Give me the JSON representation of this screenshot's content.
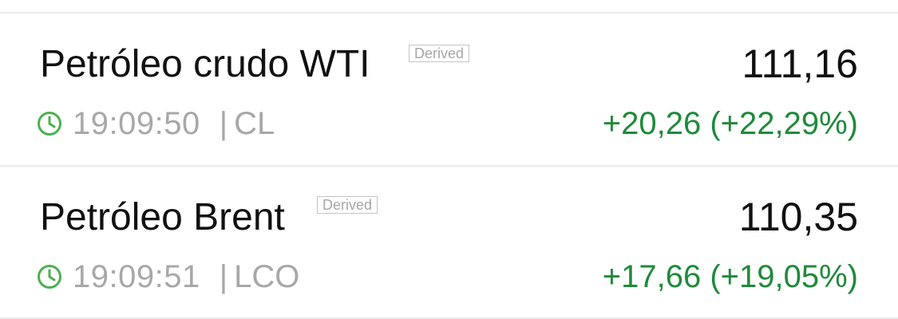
{
  "accent_up_color": "#1f8a3a",
  "clock_icon_color": "#4caf50",
  "quotes": [
    {
      "name": "Petróleo crudo WTI",
      "tag": "Derived",
      "price": "111,16",
      "time": "19:09:50",
      "separator": "|",
      "symbol": "CL",
      "change": "+20,26 (+22,29%)",
      "icon": "clock-icon"
    },
    {
      "name": "Petróleo Brent",
      "tag": "Derived",
      "price": "110,35",
      "time": "19:09:51",
      "separator": "|",
      "symbol": "LCO",
      "change": "+17,66 (+19,05%)",
      "icon": "clock-icon"
    }
  ]
}
